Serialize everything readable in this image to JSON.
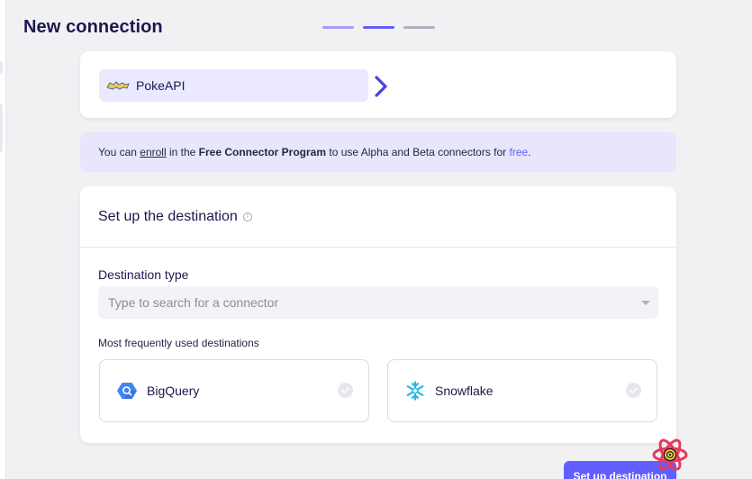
{
  "page": {
    "title": "New connection"
  },
  "steps": {
    "count": 3,
    "current": 2
  },
  "source": {
    "name": "PokeAPI",
    "logo_icon": "pokemon-logo-icon",
    "arrow_icon": "chevron-right-icon"
  },
  "banner": {
    "prefix": "You can ",
    "enroll_link": "enroll",
    "mid": " in the ",
    "program": "Free Connector Program",
    "suffix": " to use Alpha and Beta connectors for ",
    "free_link": "free",
    "end": "."
  },
  "destination": {
    "heading": "Set up the destination",
    "info_icon": "info-icon",
    "type_label": "Destination type",
    "search_placeholder": "Type to search for a connector",
    "frequent_label": "Most frequently used destinations",
    "options": [
      {
        "name": "BigQuery",
        "icon": "bigquery-icon"
      },
      {
        "name": "Snowflake",
        "icon": "snowflake-icon"
      }
    ]
  },
  "actions": {
    "setup_label": "Set up destination"
  },
  "colors": {
    "accent": "#615eff",
    "heading": "#1a194d",
    "banner_bg": "#e7e6fd",
    "source_pill_bg": "#eae9ff"
  }
}
